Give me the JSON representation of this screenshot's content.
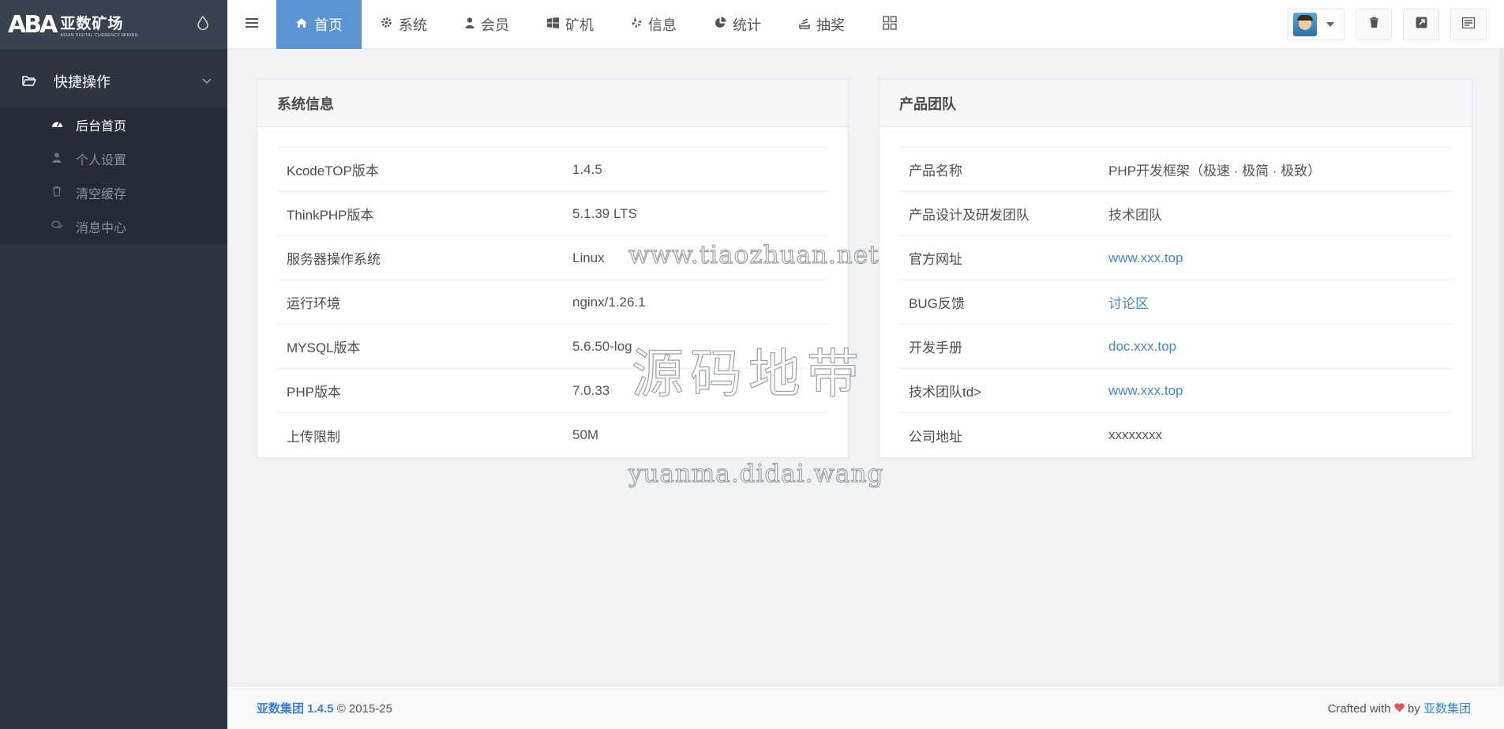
{
  "brand": {
    "logo_mark": "ABA",
    "title": "亚数矿场",
    "subtitle": "ASIAN DIGITAL CURRENCY MINING",
    "toggle_icon": "droplet-icon"
  },
  "sidebar": {
    "group_label": "快捷操作",
    "items": [
      {
        "label": "后台首页",
        "icon": "dashboard-icon",
        "active": true
      },
      {
        "label": "个人设置",
        "icon": "user-icon"
      },
      {
        "label": "清空缓存",
        "icon": "trash-icon"
      },
      {
        "label": "消息中心",
        "icon": "chat-icon"
      }
    ]
  },
  "topnav": {
    "items": [
      {
        "label": "首页",
        "icon": "home-icon",
        "active": true
      },
      {
        "label": "系统",
        "icon": "gear-icon"
      },
      {
        "label": "会员",
        "icon": "user-icon"
      },
      {
        "label": "矿机",
        "icon": "windows-icon"
      },
      {
        "label": "信息",
        "icon": "yelp-icon"
      },
      {
        "label": "统计",
        "icon": "pie-chart-icon"
      },
      {
        "label": "抽奖",
        "icon": "stack-icon"
      }
    ]
  },
  "system_info": {
    "title": "系统信息",
    "rows": [
      {
        "k": "KcodeTOP版本",
        "v": "1.4.5"
      },
      {
        "k": "ThinkPHP版本",
        "v": "5.1.39 LTS"
      },
      {
        "k": "服务器操作系统",
        "v": "Linux"
      },
      {
        "k": "运行环境",
        "v": "nginx/1.26.1"
      },
      {
        "k": "MYSQL版本",
        "v": "5.6.50-log"
      },
      {
        "k": "PHP版本",
        "v": "7.0.33"
      },
      {
        "k": "上传限制",
        "v": "50M"
      }
    ]
  },
  "team": {
    "title": "产品团队",
    "rows": [
      {
        "k": "产品名称",
        "v": "PHP开发框架（极速 · 极简 · 极致）"
      },
      {
        "k": "产品设计及研发团队",
        "v": "技术团队"
      },
      {
        "k": "官方网址",
        "v": "www.xxx.top"
      },
      {
        "k": "BUG反馈",
        "v": "讨论区"
      },
      {
        "k": "开发手册",
        "v": "doc.xxx.top"
      },
      {
        "k": "技术团队td>",
        "v": "www.xxx.top"
      },
      {
        "k": "公司地址",
        "v": "xxxxxxxx"
      }
    ]
  },
  "watermarks": {
    "line1": "www.tiaozhuan.net",
    "line2": "源码地带",
    "line3": "yuanma.didai.wang"
  },
  "footer": {
    "brand": "亚数集团 1.4.5",
    "copyright": "© 2015-25",
    "crafted": "Crafted with",
    "by": "by",
    "by_link": "亚数集团"
  },
  "colors": {
    "accent": "#5b94d3",
    "sidebar": "#2c3440",
    "link": "#4a86cc"
  }
}
